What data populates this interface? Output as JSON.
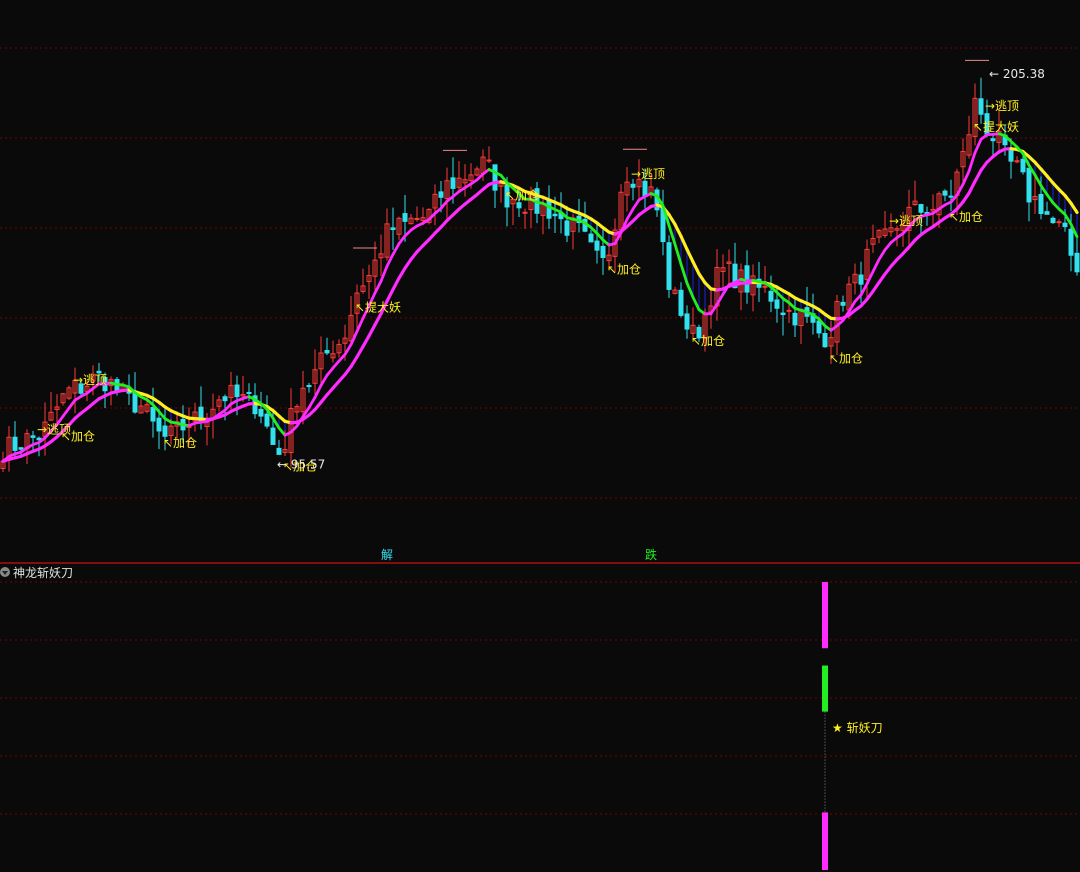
{
  "indicator": {
    "name": "神龙斩妖刀"
  },
  "colors": {
    "background": "#0a0a0a",
    "up_candle": "#ff3b3b",
    "down_candle": "#33e0ee",
    "magenta": "#ff2bff",
    "yellow": "#ffee22",
    "green": "#22ee22",
    "fill_blue": "#1a1aa8",
    "grid": "#7a0000",
    "label_yellow": "#ffee22",
    "divider": "#cc1111"
  },
  "chart_data": [
    {
      "type": "candlestick",
      "title": "",
      "price_axis": {
        "ylim": [
          80,
          215
        ],
        "log_scale": false,
        "grid": true,
        "labels": false
      },
      "price_annotations": {
        "high": {
          "value": 205.38,
          "text": "205.38"
        },
        "low": {
          "value": 95.57,
          "text": "95.57"
        }
      },
      "candles": [],
      "overlay_lines": [
        {
          "role": "fast",
          "colors": [
            "magenta",
            "green"
          ]
        },
        {
          "role": "slow",
          "colors": [
            "magenta",
            "yellow"
          ]
        }
      ],
      "signals": [
        {
          "text": "逃顶",
          "bar": 5,
          "kind": "escape"
        },
        {
          "text": "加仓",
          "bar": 9,
          "kind": "add"
        },
        {
          "text": "逃顶",
          "bar": 11,
          "kind": "escape"
        },
        {
          "text": "加仓",
          "bar": 26,
          "kind": "add"
        },
        {
          "text": "加仓",
          "bar": 46,
          "kind": "add"
        },
        {
          "text": "提大妖",
          "bar": 58,
          "kind": "monster"
        },
        {
          "text": "加仓",
          "bar": 83,
          "kind": "add"
        },
        {
          "text": "加仓",
          "bar": 100,
          "kind": "add"
        },
        {
          "text": "逃顶",
          "bar": 104,
          "kind": "escape"
        },
        {
          "text": "加仓",
          "bar": 114,
          "kind": "add"
        },
        {
          "text": "加仓",
          "bar": 137,
          "kind": "add"
        },
        {
          "text": "逃顶",
          "bar": 147,
          "kind": "escape"
        },
        {
          "text": "加仓",
          "bar": 157,
          "kind": "add"
        },
        {
          "text": "提大妖",
          "bar": 161,
          "kind": "monster"
        },
        {
          "text": "逃顶",
          "bar": 163,
          "kind": "escape"
        }
      ],
      "caution_marks": [
        {
          "bar": 60
        },
        {
          "bar": 75
        },
        {
          "bar": 105
        },
        {
          "bar": 162
        }
      ],
      "bottom_marks": [
        {
          "text": "解",
          "bar": 63,
          "color": "#33e0ee"
        },
        {
          "text": "跌",
          "bar": 107,
          "color": "#22ee22"
        }
      ]
    },
    {
      "type": "bar",
      "title": "神龙斩妖刀",
      "signal_bar": 142,
      "signal_label": "斩妖刀",
      "segments": [
        {
          "color": "magenta",
          "from": 1.0,
          "to": 0.77
        },
        {
          "color": "green",
          "from": 0.71,
          "to": 0.55
        },
        {
          "color": "dashed",
          "from": 0.55,
          "to": 0.2
        },
        {
          "color": "magenta",
          "from": 0.2,
          "to": 0.0
        }
      ]
    }
  ]
}
